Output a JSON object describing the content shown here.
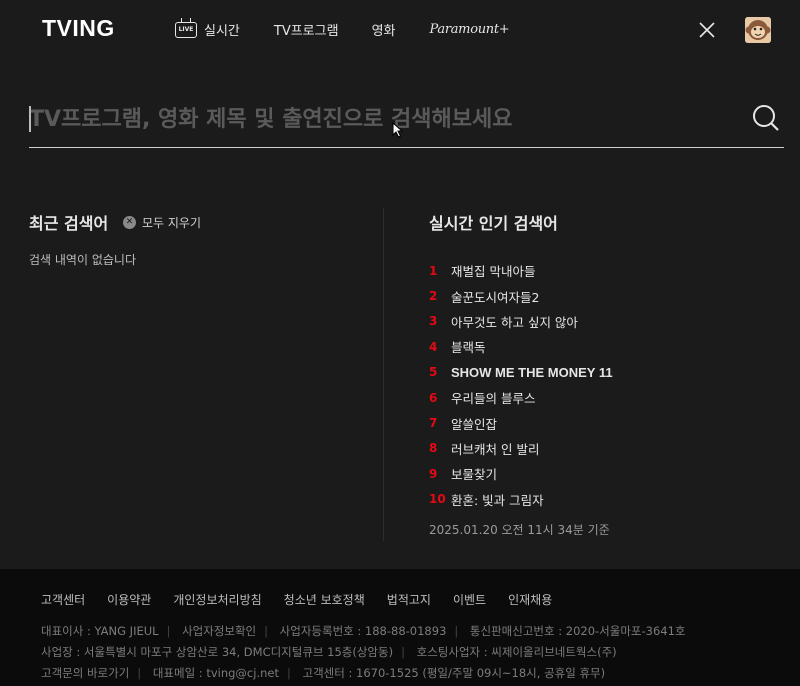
{
  "header": {
    "logo": "TVING",
    "nav": [
      {
        "label": "실시간",
        "icon": "live-tv-icon"
      },
      {
        "label": "TV프로그램"
      },
      {
        "label": "영화"
      },
      {
        "label": "Paramount+"
      }
    ]
  },
  "search": {
    "placeholder": "TV프로그램, 영화 제목 및 출연진으로 검색해보세요",
    "value": ""
  },
  "recent": {
    "title": "최근 검색어",
    "clear_label": "모두 지우기",
    "empty_message": "검색 내역이 없습니다"
  },
  "popular": {
    "title": "실시간 인기 검색어",
    "items": [
      {
        "rank": "1",
        "title": "재벌집 막내아들"
      },
      {
        "rank": "2",
        "title": "술꾼도시여자들2"
      },
      {
        "rank": "3",
        "title": "아무것도 하고 싶지 않아"
      },
      {
        "rank": "4",
        "title": "블랙독"
      },
      {
        "rank": "5",
        "title": "SHOW ME THE MONEY 11"
      },
      {
        "rank": "6",
        "title": "우리들의 블루스"
      },
      {
        "rank": "7",
        "title": "알쓸인잡"
      },
      {
        "rank": "8",
        "title": "러브캐처 인 발리"
      },
      {
        "rank": "9",
        "title": "보물찾기"
      },
      {
        "rank": "10",
        "title": "환혼: 빛과 그림자"
      }
    ],
    "timestamp": "2025.01.20 오전 11시 34분 기준"
  },
  "footer": {
    "links": [
      "고객센터",
      "이용약관",
      "개인정보처리방침",
      "청소년 보호정책",
      "법적고지",
      "이벤트",
      "인재채용"
    ],
    "line1": [
      "대표이사 : YANG JIEUL",
      "사업자정보확인",
      "사업자등록번호 : 188-88-01893",
      "통신판매신고번호 : 2020-서울마포-3641호"
    ],
    "line2": [
      "사업장 : 서울특별시 마포구 상암산로 34, DMC디지털큐브 15층(상암동)",
      "호스팅사업자 : 씨제이올리브네트웍스(주)"
    ],
    "line3": [
      "고객문의 바로가기",
      "대표메일 : tving@cj.net",
      "고객센터 : 1670-1525 (평일/주말 09시~18시, 공휴일 휴무)"
    ]
  },
  "colors": {
    "accent": "#e50914",
    "background": "#1b1b1b",
    "footer_bg": "#0b0b0b"
  }
}
